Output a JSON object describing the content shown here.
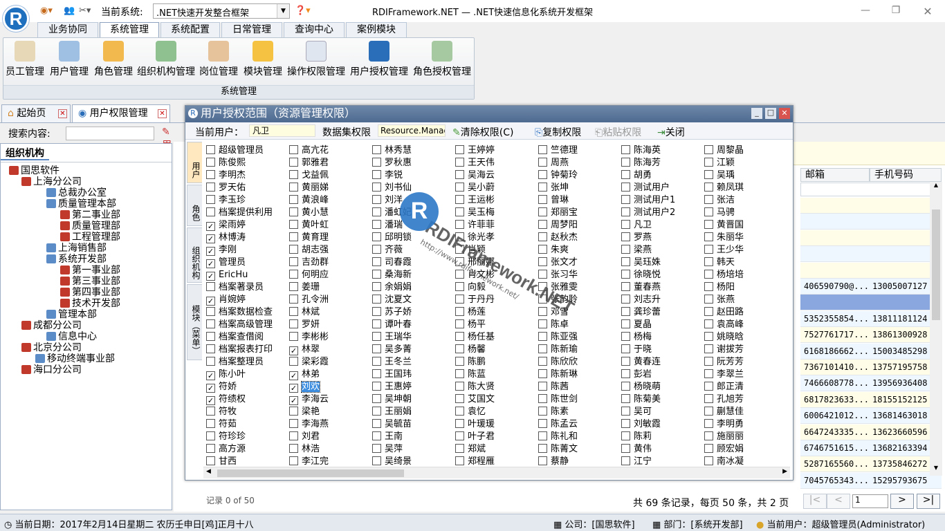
{
  "app": {
    "title": "RDIFramework.NET — .NET快速信息化系统开发框架",
    "current_system_label": "当前系统:",
    "current_system": ".NET快速开发整合框架",
    "logo_letter": "R"
  },
  "menu_tabs": [
    "业务协同",
    "系统管理",
    "系统配置",
    "日常管理",
    "查询中心",
    "案例模块"
  ],
  "ribbon": {
    "buttons": [
      {
        "label": "员工管理",
        "icon": "employee-icon"
      },
      {
        "label": "用户管理",
        "icon": "user-icon"
      },
      {
        "label": "角色管理",
        "icon": "role-icon"
      },
      {
        "label": "组织机构管理",
        "icon": "org-icon"
      },
      {
        "label": "岗位管理",
        "icon": "post-icon"
      },
      {
        "label": "模块管理",
        "icon": "module-icon"
      },
      {
        "label": "操作权限管理",
        "icon": "permission-icon"
      },
      {
        "label": "用户授权管理",
        "icon": "user-auth-icon"
      },
      {
        "label": "角色授权管理",
        "icon": "role-auth-icon"
      }
    ],
    "group": "系统管理"
  },
  "doc_tabs": [
    "起始页",
    "用户权限管理"
  ],
  "search": {
    "label": "搜索内容:",
    "btn": "用"
  },
  "org": {
    "title": "组织机构",
    "nodes": [
      "国思软件",
      "上海分公司",
      "总裁办公室",
      "质量管理本部",
      "第二事业部",
      "质量管理部",
      "工程管理部",
      "上海销售部",
      "系统开发部",
      "第一事业部",
      "第三事业部",
      "第四事业部",
      "技术开发部",
      "管理本部",
      "成都分公司",
      "信息中心",
      "北京分公司",
      "移动终端事业部",
      "海口分公司"
    ]
  },
  "grid": {
    "columns": [
      "邮箱",
      "手机号码"
    ],
    "rows": [
      [
        "",
        ""
      ],
      [
        "",
        ""
      ],
      [
        "",
        ""
      ],
      [
        "",
        ""
      ],
      [
        "",
        ""
      ],
      [
        "406590790@...",
        "13005007127"
      ],
      [
        "",
        ""
      ],
      [
        "5352355854...",
        "13811181124"
      ],
      [
        "7527761717...",
        "13861300928"
      ],
      [
        "6168186662...",
        "15003485298"
      ],
      [
        "7367101410...",
        "13757195758"
      ],
      [
        "7466608778...",
        "13956936408"
      ],
      [
        "6817823633...",
        "18155152125"
      ],
      [
        "6006421012...",
        "13681463018"
      ],
      [
        "6647243335...",
        "13623660596"
      ],
      [
        "6746751615...",
        "13682163394"
      ],
      [
        "5287165560...",
        "13735846272"
      ],
      [
        "7045765343...",
        "15295793675"
      ]
    ]
  },
  "pager": {
    "info": "共 69 条记录，每页 50 条，共 2 页",
    "page": "1",
    "records": "记录 0 of 50"
  },
  "status": {
    "date": "当前日期：2017年2月14日星期二 农历壬申日[鸡]正月十八",
    "company": "公司：[国思软件]",
    "dept": "部门：[系统开发部]",
    "user": "当前用户：超级管理员(Administrator)"
  },
  "dialog": {
    "title": "用户授权范围（资源管理权限）",
    "cur_user_label": "当前用户：",
    "cur_user": "凡卫",
    "ds_label": "数据集权限",
    "ds_value": "Resource.Manag",
    "clear": "清除权限(C)",
    "copy": "复制权限",
    "paste": "粘贴权限",
    "close": "关闭",
    "side_tabs": [
      "用户",
      "角色",
      "组织机构",
      "模块（菜单）"
    ],
    "columns": [
      [
        [
          "超级管理员",
          0
        ],
        [
          "陈俊熙",
          0
        ],
        [
          "李明杰",
          0
        ],
        [
          "罗天佑",
          0
        ],
        [
          "李玉珍",
          0
        ],
        [
          "档案提供利用",
          0
        ],
        [
          "梁雨婷",
          1
        ],
        [
          "林博涛",
          1
        ],
        [
          "李刚",
          1
        ],
        [
          "管理员",
          1
        ],
        [
          "EricHu",
          1
        ],
        [
          "档案著录员",
          0
        ],
        [
          "肖婉婷",
          1
        ],
        [
          "档案数据检查",
          0
        ],
        [
          "档案高级管理",
          0
        ],
        [
          "档案查借阅",
          0
        ],
        [
          "档案报表打印",
          0
        ],
        [
          "档案整理员",
          0
        ],
        [
          "陈小叶",
          1
        ],
        [
          "符娇",
          1
        ],
        [
          "符绩权",
          1
        ],
        [
          "符牧",
          0
        ],
        [
          "符茹",
          0
        ],
        [
          "符珍珍",
          0
        ],
        [
          "高方源",
          0
        ],
        [
          "甘西",
          0
        ]
      ],
      [
        [
          "高亢花",
          0
        ],
        [
          "郭雅君",
          0
        ],
        [
          "戈益佩",
          0
        ],
        [
          "黄丽娣",
          0
        ],
        [
          "黄浪峰",
          0
        ],
        [
          "黄小慧",
          0
        ],
        [
          "黄叶虹",
          0
        ],
        [
          "黄育理",
          0
        ],
        [
          "胡志强",
          0
        ],
        [
          "吉劲群",
          0
        ],
        [
          "何明应",
          0
        ],
        [
          "姜珊",
          0
        ],
        [
          "孔令洲",
          0
        ],
        [
          "林斌",
          0
        ],
        [
          "罗妍",
          0
        ],
        [
          "李彬彬",
          0
        ],
        [
          "林翠",
          1
        ],
        [
          "梁彩霞",
          0
        ],
        [
          "林弟",
          1
        ],
        [
          "刘欢",
          1
        ],
        [
          "李海云",
          1
        ],
        [
          "梁艳",
          0
        ],
        [
          "李海燕",
          0
        ],
        [
          "刘君",
          0
        ],
        [
          "林浩",
          0
        ],
        [
          "李江完",
          0
        ]
      ],
      [
        [
          "林秀慧",
          0
        ],
        [
          "罗秋惠",
          0
        ],
        [
          "李锐",
          0
        ],
        [
          "刘书仙",
          0
        ],
        [
          "刘洋",
          0
        ],
        [
          "潘虹妃",
          0
        ],
        [
          "潘瑞",
          0
        ],
        [
          "邱明锁",
          0
        ],
        [
          "齐薇",
          0
        ],
        [
          "司春霞",
          0
        ],
        [
          "桑海新",
          0
        ],
        [
          "余娟娟",
          0
        ],
        [
          "沈夏文",
          0
        ],
        [
          "苏子娇",
          0
        ],
        [
          "谭叶春",
          0
        ],
        [
          "王瑞华",
          0
        ],
        [
          "吴多菁",
          0
        ],
        [
          "王冬兰",
          0
        ],
        [
          "王国玮",
          0
        ],
        [
          "王惠婷",
          0
        ],
        [
          "吴坤朝",
          0
        ],
        [
          "王丽娟",
          0
        ],
        [
          "吴毓苗",
          0
        ],
        [
          "王南",
          0
        ],
        [
          "吴萍",
          0
        ],
        [
          "吴绮景",
          0
        ]
      ],
      [
        [
          "王婷婷",
          0
        ],
        [
          "王天伟",
          0
        ],
        [
          "吴海云",
          0
        ],
        [
          "吴小蔚",
          0
        ],
        [
          "王运彬",
          0
        ],
        [
          "吴玉梅",
          0
        ],
        [
          "许菲菲",
          0
        ],
        [
          "徐光孝",
          0
        ],
        [
          "肖颖",
          0
        ],
        [
          "邢丽娜",
          0
        ],
        [
          "肖文彬",
          0
        ],
        [
          "向毅",
          0
        ],
        [
          "于丹丹",
          0
        ],
        [
          "杨莲",
          0
        ],
        [
          "杨平",
          0
        ],
        [
          "杨任基",
          0
        ],
        [
          "杨馨",
          0
        ],
        [
          "陈鹏",
          0
        ],
        [
          "陈蓝",
          0
        ],
        [
          "陈大贤",
          0
        ],
        [
          "艾国文",
          0
        ],
        [
          "袁忆",
          0
        ],
        [
          "叶瑗瑗",
          0
        ],
        [
          "叶子君",
          0
        ],
        [
          "郑斌",
          0
        ],
        [
          "郑程雁",
          0
        ]
      ],
      [
        [
          "竺德理",
          0
        ],
        [
          "周燕",
          0
        ],
        [
          "钟菊玲",
          0
        ],
        [
          "张坤",
          0
        ],
        [
          "曾琳",
          0
        ],
        [
          "郑丽宝",
          0
        ],
        [
          "周梦阳",
          0
        ],
        [
          "赵秋杰",
          0
        ],
        [
          "朱爽",
          0
        ],
        [
          "张文才",
          0
        ],
        [
          "张习华",
          0
        ],
        [
          "张雅雯",
          0
        ],
        [
          "张韵聆",
          0
        ],
        [
          "邓雪",
          0
        ],
        [
          "陈卓",
          0
        ],
        [
          "陈亚强",
          0
        ],
        [
          "陈新瑜",
          0
        ],
        [
          "陈欣欣",
          0
        ],
        [
          "陈新琳",
          0
        ],
        [
          "陈茜",
          0
        ],
        [
          "陈世剑",
          0
        ],
        [
          "陈素",
          0
        ],
        [
          "陈孟云",
          0
        ],
        [
          "陈礼和",
          0
        ],
        [
          "陈菁文",
          0
        ],
        [
          "蔡静",
          0
        ]
      ],
      [
        [
          "陈海英",
          0
        ],
        [
          "陈海芳",
          0
        ],
        [
          "胡勇",
          0
        ],
        [
          "测试用户",
          0
        ],
        [
          "测试用户1",
          0
        ],
        [
          "测试用户2",
          0
        ],
        [
          "凡卫",
          0
        ],
        [
          "罗燕",
          0
        ],
        [
          "梁燕",
          0
        ],
        [
          "吴珏姝",
          0
        ],
        [
          "徐晓悦",
          0
        ],
        [
          "董春燕",
          0
        ],
        [
          "刘志升",
          0
        ],
        [
          "龚珍蕾",
          0
        ],
        [
          "夏晶",
          0
        ],
        [
          "杨梅",
          0
        ],
        [
          "于晓",
          0
        ],
        [
          "黄春连",
          0
        ],
        [
          "彭岩",
          0
        ],
        [
          "杨晓萌",
          0
        ],
        [
          "陈菊美",
          0
        ],
        [
          "吴可",
          0
        ],
        [
          "刘敏霞",
          0
        ],
        [
          "陈莉",
          0
        ],
        [
          "黄伟",
          0
        ],
        [
          "江宁",
          0
        ]
      ],
      [
        [
          "周黎晶",
          0
        ],
        [
          "江颖",
          0
        ],
        [
          "吴瑀",
          0
        ],
        [
          "赖凤琪",
          0
        ],
        [
          "张洁",
          0
        ],
        [
          "马骋",
          0
        ],
        [
          "黄晋国",
          0
        ],
        [
          "朱丽华",
          0
        ],
        [
          "王少华",
          0
        ],
        [
          "韩天",
          0
        ],
        [
          "杨培培",
          0
        ],
        [
          "杨阳",
          0
        ],
        [
          "张燕",
          0
        ],
        [
          "赵田路",
          0
        ],
        [
          "袁高峰",
          0
        ],
        [
          "姚晓晗",
          0
        ],
        [
          "谢拔芳",
          0
        ],
        [
          "阮芳芳",
          0
        ],
        [
          "李翠兰",
          0
        ],
        [
          "郎正清",
          0
        ],
        [
          "孔旭芳",
          0
        ],
        [
          "蒯慧佳",
          0
        ],
        [
          "李明勇",
          0
        ],
        [
          "施丽丽",
          0
        ],
        [
          "顾宏娟",
          0
        ],
        [
          "南冰凝",
          0
        ]
      ]
    ]
  },
  "watermark": {
    "brand": "RDIFramework.NET",
    "url": "http://www.rdiframework.net/"
  }
}
